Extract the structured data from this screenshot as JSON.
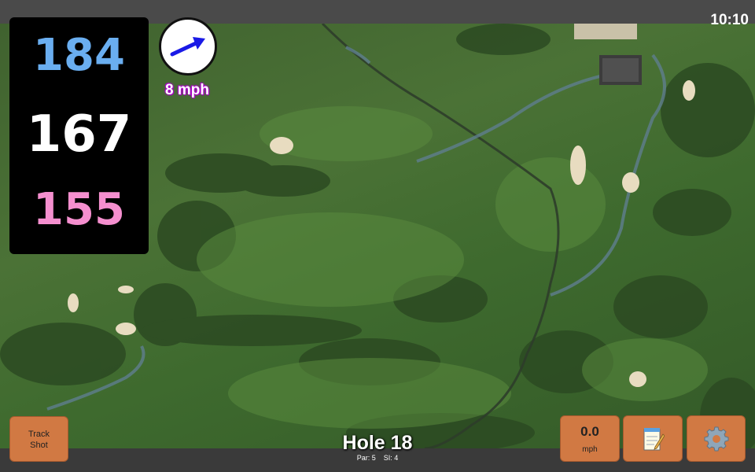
{
  "status": {
    "time": "10:10"
  },
  "yardages": {
    "back": "184",
    "center": "167",
    "front": "155",
    "colors": {
      "back": "#6aaef0",
      "center": "#ffffff",
      "front": "#f58fcf"
    }
  },
  "wind": {
    "speed": "8 mph",
    "arrow_color": "#1a1ae6",
    "icon": "wind-direction-arrow"
  },
  "buttons": {
    "track_line1": "Track",
    "track_line2": "Shot",
    "speed_value": "0.0",
    "speed_unit": "mph",
    "notes_icon": "notepad-icon",
    "settings_icon": "gear-icon",
    "color": "#d17943"
  },
  "hole": {
    "title": "Hole 18",
    "par": "Par: 5",
    "si": "SI: 4"
  }
}
